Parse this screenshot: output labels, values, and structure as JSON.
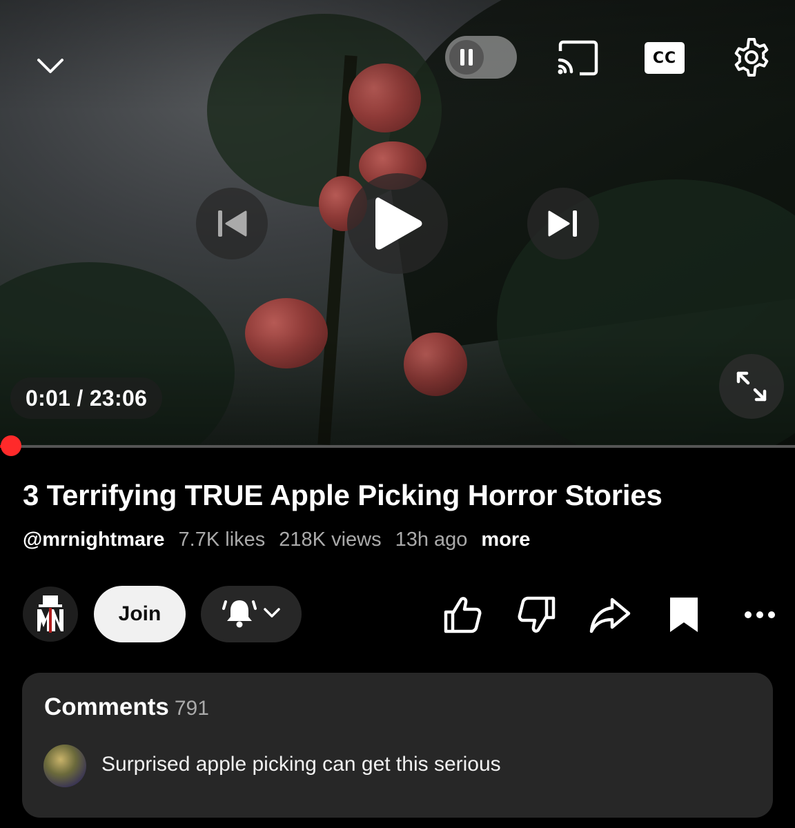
{
  "player": {
    "time_current": "0:01",
    "time_total": "23:06",
    "time_display": "0:01 / 23:06",
    "progress": 0.0007,
    "cc_label": "CC",
    "accent_color": "#ff0000"
  },
  "icons": {
    "minimize": "chevron-down-icon",
    "pause": "pause-icon",
    "cast": "cast-icon",
    "captions": "cc-icon",
    "settings": "gear-icon",
    "previous": "skip-previous-icon",
    "play": "play-icon",
    "next": "skip-next-icon",
    "fullscreen": "fullscreen-icon"
  },
  "video": {
    "title": "3 Terrifying TRUE Apple Picking Horror Stories",
    "channel_handle": "@mrnightmare",
    "likes": "7.7K likes",
    "views": "218K views",
    "age": "13h ago",
    "more_label": "more"
  },
  "actions": {
    "join_label": "Join"
  },
  "comments": {
    "heading": "Comments",
    "count": "791",
    "top_comment": "Surprised apple picking can get this serious"
  }
}
